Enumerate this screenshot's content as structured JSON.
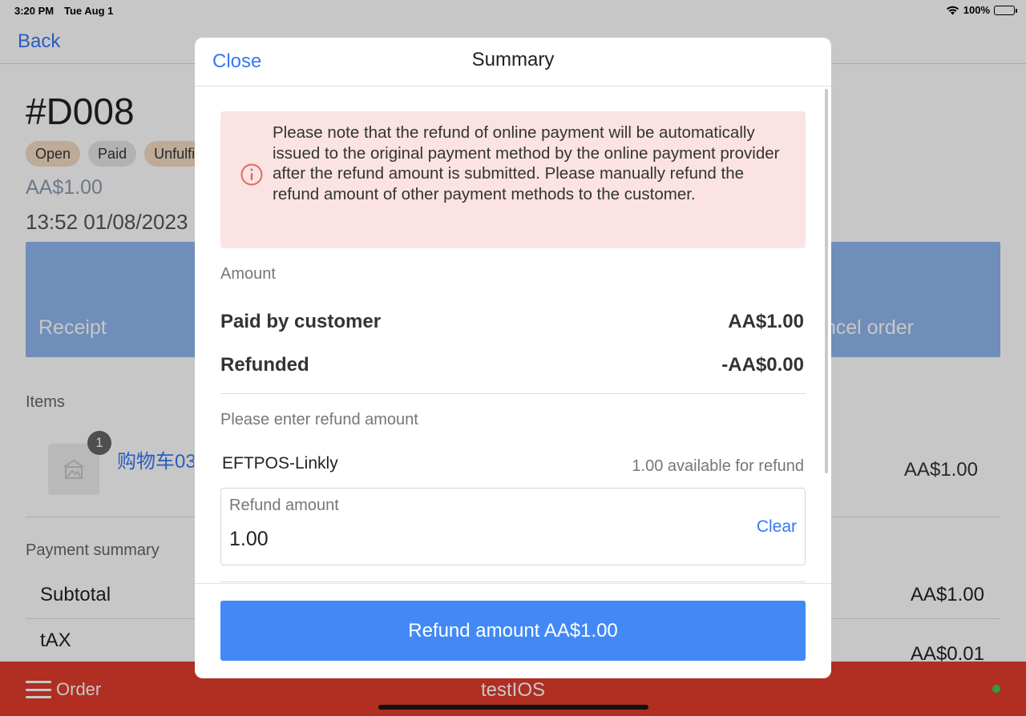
{
  "status_bar": {
    "time": "3:20 PM",
    "date": "Tue Aug 1",
    "battery": "100%"
  },
  "nav": {
    "back_label": "Back"
  },
  "order": {
    "number": "#D008",
    "badges": [
      "Open",
      "Paid",
      "Unfulfi"
    ],
    "amount": "AA$1.00",
    "datetime": "13:52 01/08/2023 I",
    "actions": {
      "receipt": "Receipt",
      "cancel": "ncel order"
    },
    "items_heading": "Items",
    "item": {
      "qty": "1",
      "name": "购物车03",
      "price": "AA$1.00"
    },
    "payment_heading": "Payment summary",
    "subtotal_label": "Subtotal",
    "subtotal_value": "AA$1.00",
    "tax_label": "tAX",
    "tax_value": "AA$0.01"
  },
  "bottom_bar": {
    "menu_label": "Order",
    "store_name": "testIOS"
  },
  "modal": {
    "close_label": "Close",
    "title": "Summary",
    "notice": "Please note that the refund of online payment will be automatically issued to the original payment method by the online payment provider after the refund amount is submitted. Please manually refund the refund amount of other payment methods to the customer.",
    "amount_heading": "Amount",
    "paid_label": "Paid by customer",
    "paid_value": "AA$1.00",
    "refunded_label": "Refunded",
    "refunded_value": "-AA$0.00",
    "refund_heading": "Please enter refund amount",
    "method_name": "EFTPOS-Linkly",
    "available_text": "1.00 available for refund",
    "refund_field_label": "Refund amount",
    "refund_field_value": "1.00",
    "clear_label": "Clear",
    "submit_label": "Refund amount AA$1.00"
  },
  "colors": {
    "accent": "#3478f6",
    "primary_button": "#4289f5",
    "notice_bg": "#fae3e2",
    "notice_icon": "#e06a5e",
    "bottom_bar": "#e23c2c",
    "online": "#35d04a"
  },
  "icons": [
    "wifi-icon",
    "battery-icon",
    "menu-icon",
    "info-icon",
    "image-placeholder-icon"
  ]
}
